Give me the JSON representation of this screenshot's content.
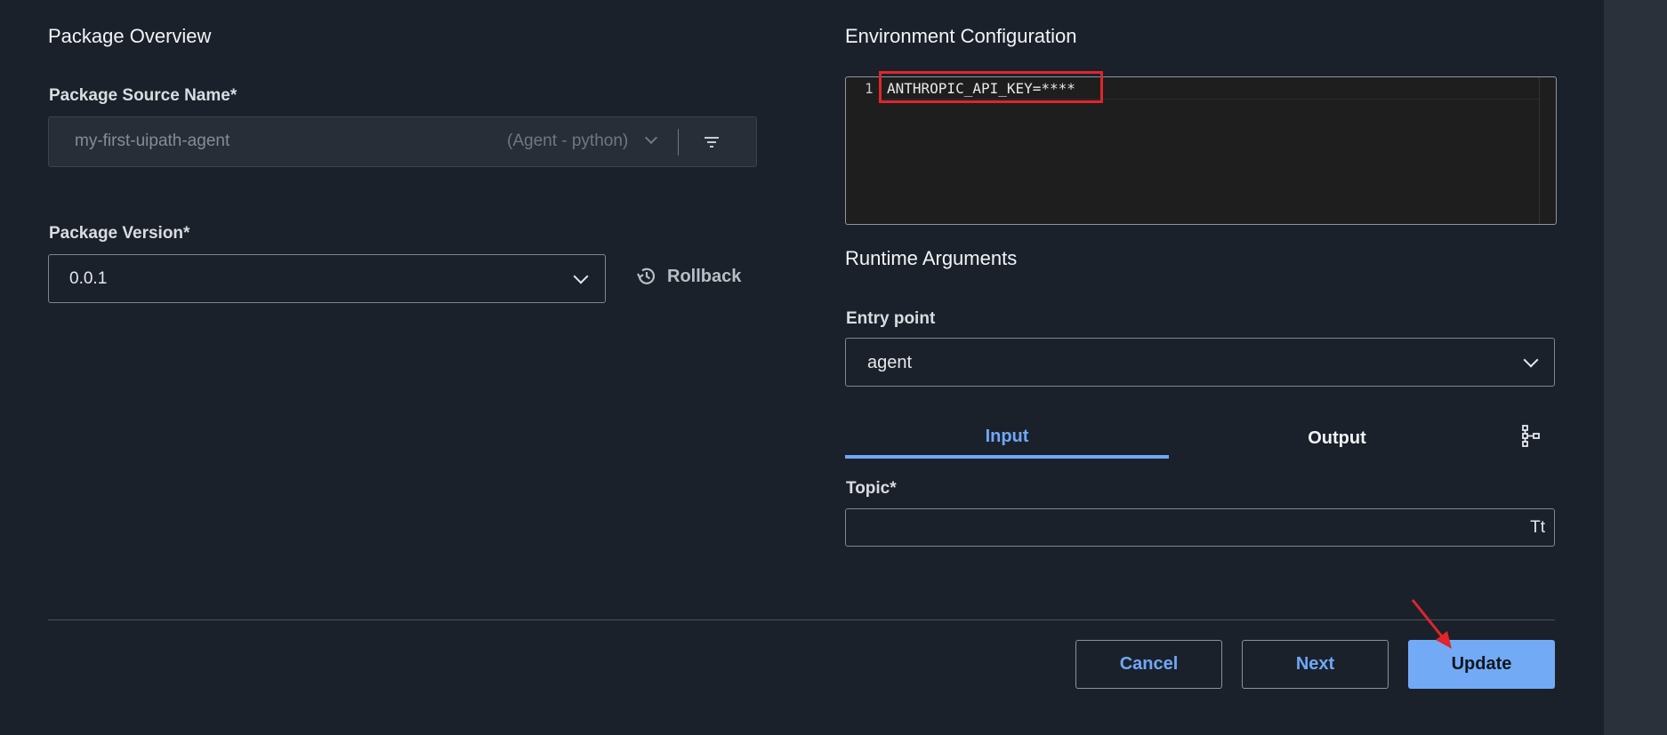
{
  "overview": {
    "title": "Package Overview",
    "source_label": "Package Source Name*",
    "source_value": "my-first-uipath-agent",
    "source_type": "(Agent - python)",
    "version_label": "Package Version*",
    "version_value": "0.0.1",
    "rollback_label": "Rollback"
  },
  "env": {
    "title": "Environment Configuration",
    "line_number": "1",
    "line_text": "ANTHROPIC_API_KEY=****"
  },
  "runtime": {
    "title": "Runtime Arguments",
    "entry_label": "Entry point",
    "entry_value": "agent",
    "tabs": [
      {
        "label": "Input",
        "active": true
      },
      {
        "label": "Output",
        "active": false
      }
    ],
    "topic_label": "Topic*",
    "topic_value": "",
    "type_icon_text": "Tt"
  },
  "footer": {
    "cancel_label": "Cancel",
    "next_label": "Next",
    "update_label": "Update"
  },
  "colors": {
    "accent": "#6ea8f7",
    "highlight_border": "#e0252b",
    "background": "#1b212b"
  }
}
